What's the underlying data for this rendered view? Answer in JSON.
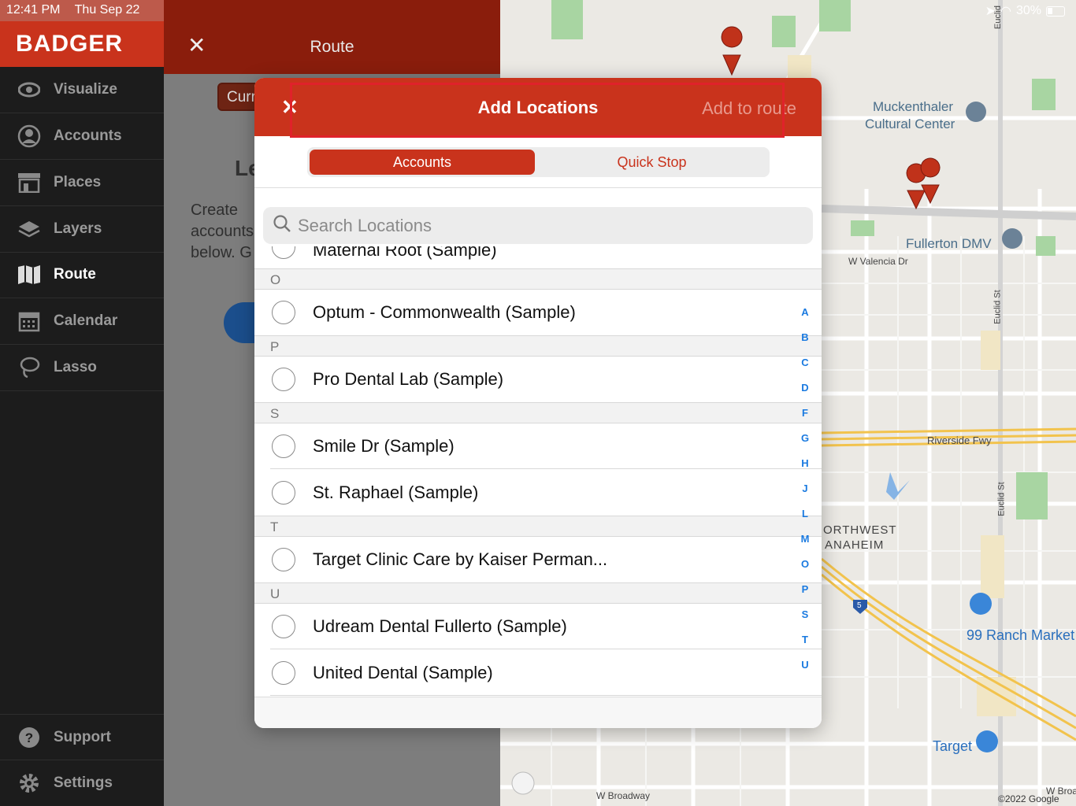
{
  "status": {
    "time": "12:41 PM",
    "date": "Thu Sep 22",
    "battery": "30%"
  },
  "brand": "BADGER",
  "nav": [
    {
      "label": "Visualize",
      "icon": "eye-icon"
    },
    {
      "label": "Accounts",
      "icon": "user-circle-icon"
    },
    {
      "label": "Places",
      "icon": "store-icon"
    },
    {
      "label": "Layers",
      "icon": "layers-icon"
    },
    {
      "label": "Route",
      "icon": "map-icon",
      "active": true
    },
    {
      "label": "Calendar",
      "icon": "calendar-icon"
    },
    {
      "label": "Lasso",
      "icon": "lasso-icon"
    }
  ],
  "nav_bottom": [
    {
      "label": "Support",
      "icon": "help-icon"
    },
    {
      "label": "Settings",
      "icon": "gear-icon"
    }
  ],
  "route": {
    "title": "Route",
    "current_button": "Curr",
    "heading": "Le",
    "desc_lines": [
      "Create",
      "accounts",
      "below. G"
    ]
  },
  "modal": {
    "title": "Add Locations",
    "action": "Add to route",
    "tabs": {
      "accounts": "Accounts",
      "quick_stop": "Quick Stop"
    },
    "search_placeholder": "Search Locations",
    "cut_item": "Maternal Root (Sample)",
    "sections": [
      {
        "letter": "O",
        "items": [
          "Optum - Commonwealth (Sample)"
        ]
      },
      {
        "letter": "P",
        "items": [
          "Pro Dental Lab (Sample)"
        ]
      },
      {
        "letter": "S",
        "items": [
          "Smile Dr (Sample)",
          "St. Raphael (Sample)"
        ]
      },
      {
        "letter": "T",
        "items": [
          "Target Clinic Care by Kaiser Perman..."
        ]
      },
      {
        "letter": "U",
        "items": [
          "Udream Dental Fullerto (Sample)",
          "United Dental (Sample)"
        ]
      }
    ],
    "index_letters": [
      "A",
      "B",
      "C",
      "D",
      "F",
      "G",
      "H",
      "J",
      "L",
      "M",
      "O",
      "P",
      "S",
      "T",
      "U"
    ]
  },
  "map_labels": {
    "muckenthaler": "Muckenthaler",
    "cultural_center": "Cultural Center",
    "fullerton_dmv": "Fullerton DMV",
    "valencia": "W Valencia Dr",
    "riverside": "Riverside Fwy",
    "euclid1": "Euclid St",
    "euclid2": "Euclid St",
    "euclid_top": "Euclid",
    "nw1": "ORTHWEST",
    "nw2": "ANAHEIM",
    "ranch": "99 Ranch Market",
    "target": "Target",
    "broadway": "W Broadway",
    "broadway2": "W Broa",
    "copyright": "©2022 Google",
    "shield": "5"
  },
  "colors": {
    "brand_red": "#c9331c",
    "sidebar": "#1c1c1c",
    "link_blue": "#1a7ae0"
  }
}
